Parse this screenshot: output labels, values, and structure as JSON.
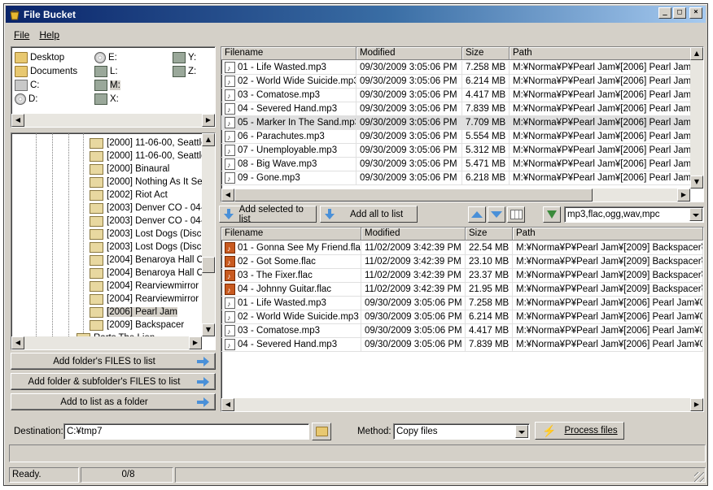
{
  "window": {
    "title": "File Bucket"
  },
  "menu": [
    {
      "label": "File"
    },
    {
      "label": "Help"
    }
  ],
  "drives": [
    {
      "label": "Desktop",
      "icon": "desktop-folder-icon"
    },
    {
      "label": "Documents",
      "icon": "documents-folder-icon"
    },
    {
      "label": "C:",
      "icon": "hard-drive-icon"
    },
    {
      "label": "D:",
      "icon": "cd-drive-icon"
    },
    {
      "label": "E:",
      "icon": "cd-drive-icon"
    },
    {
      "label": "L:",
      "icon": "network-drive-icon"
    },
    {
      "label": "M:",
      "icon": "network-drive-icon"
    },
    {
      "label": "X:",
      "icon": "network-drive-icon"
    },
    {
      "label": "Y:",
      "icon": "network-drive-icon"
    },
    {
      "label": "Z:",
      "icon": "network-drive-icon"
    }
  ],
  "tree": [
    "[2000] 11-06-00, Seattle",
    "[2000] 11-06-00, Seattle",
    "[2000] Binaural",
    "[2000] Nothing As It Se",
    "[2002] Riot Act",
    "[2003] Denver CO - 04-",
    "[2003] Denver CO - 04-",
    "[2003] Lost Dogs (Disc",
    "[2003] Lost Dogs (Disc",
    "[2004] Benaroya Hall O",
    "[2004] Benaroya Hall O",
    "[2004] Rearviewmirror (",
    "[2004] Rearviewmirror (",
    "[2006] Pearl Jam",
    "[2009] Backspacer",
    "Rarts The Lion"
  ],
  "tree_selected": "[2006] Pearl Jam",
  "left_buttons": [
    "Add folder's FILES to list",
    "Add folder & subfolder's FILES to list",
    "Add to list as a folder"
  ],
  "top_list": {
    "columns": [
      "Filename",
      "Modified",
      "Size",
      "Path"
    ],
    "rows": [
      [
        "01 - Life Wasted.mp3",
        "09/30/2009 3:05:06 PM",
        "7.258 MB",
        "M:¥Norma¥P¥Pearl Jam¥[2006] Pearl Jam¥01"
      ],
      [
        "02 - World Wide Suicide.mp3",
        "09/30/2009 3:05:06 PM",
        "6.214 MB",
        "M:¥Norma¥P¥Pearl Jam¥[2006] Pearl Jam¥02"
      ],
      [
        "03 - Comatose.mp3",
        "09/30/2009 3:05:06 PM",
        "4.417 MB",
        "M:¥Norma¥P¥Pearl Jam¥[2006] Pearl Jam¥03"
      ],
      [
        "04 - Severed Hand.mp3",
        "09/30/2009 3:05:06 PM",
        "7.839 MB",
        "M:¥Norma¥P¥Pearl Jam¥[2006] Pearl Jam¥04"
      ],
      [
        "05 - Marker In The Sand.mp3",
        "09/30/2009 3:05:06 PM",
        "7.709 MB",
        "M:¥Norma¥P¥Pearl Jam¥[2006] Pearl Jam¥05"
      ],
      [
        "06 - Parachutes.mp3",
        "09/30/2009 3:05:06 PM",
        "5.554 MB",
        "M:¥Norma¥P¥Pearl Jam¥[2006] Pearl Jam¥06"
      ],
      [
        "07 - Unemployable.mp3",
        "09/30/2009 3:05:06 PM",
        "5.312 MB",
        "M:¥Norma¥P¥Pearl Jam¥[2006] Pearl Jam¥07"
      ],
      [
        "08 - Big Wave.mp3",
        "09/30/2009 3:05:06 PM",
        "5.471 MB",
        "M:¥Norma¥P¥Pearl Jam¥[2006] Pearl Jam¥08"
      ],
      [
        "09 - Gone.mp3",
        "09/30/2009 3:05:06 PM",
        "6.218 MB",
        "M:¥Norma¥P¥Pearl Jam¥[2006] Pearl Jam¥09"
      ]
    ],
    "selected_index": 4
  },
  "toolbar": {
    "add_selected": "Add selected to list",
    "add_all": "Add all to list",
    "filter_value": "mp3,flac,ogg,wav,mpc"
  },
  "bottom_list": {
    "columns": [
      "Filename",
      "Modified",
      "Size",
      "Path"
    ],
    "rows": [
      [
        "01 - Gonna See My Friend.flac",
        "11/02/2009 3:42:39 PM",
        "22.54 MB",
        "M:¥Norma¥P¥Pearl Jam¥[2009] Backspacer¥01",
        "flac"
      ],
      [
        "02 - Got Some.flac",
        "11/02/2009 3:42:39 PM",
        "23.10 MB",
        "M:¥Norma¥P¥Pearl Jam¥[2009] Backspacer¥02",
        "flac"
      ],
      [
        "03 - The Fixer.flac",
        "11/02/2009 3:42:39 PM",
        "23.37 MB",
        "M:¥Norma¥P¥Pearl Jam¥[2009] Backspacer¥03",
        "flac"
      ],
      [
        "04 - Johnny Guitar.flac",
        "11/02/2009 3:42:39 PM",
        "21.95 MB",
        "M:¥Norma¥P¥Pearl Jam¥[2009] Backspacer¥04",
        "flac"
      ],
      [
        "01 - Life Wasted.mp3",
        "09/30/2009 3:05:06 PM",
        "7.258 MB",
        "M:¥Norma¥P¥Pearl Jam¥[2006] Pearl Jam¥01 - L",
        "mp3"
      ],
      [
        "02 - World Wide Suicide.mp3",
        "09/30/2009 3:05:06 PM",
        "6.214 MB",
        "M:¥Norma¥P¥Pearl Jam¥[2006] Pearl Jam¥02 - V",
        "mp3"
      ],
      [
        "03 - Comatose.mp3",
        "09/30/2009 3:05:06 PM",
        "4.417 MB",
        "M:¥Norma¥P¥Pearl Jam¥[2006] Pearl Jam¥03 - C",
        "mp3"
      ],
      [
        "04 - Severed Hand.mp3",
        "09/30/2009 3:05:06 PM",
        "7.839 MB",
        "M:¥Norma¥P¥Pearl Jam¥[2006] Pearl Jam¥04 - S",
        "mp3"
      ]
    ]
  },
  "destination": {
    "label": "Destination:",
    "value": "C:¥tmp7"
  },
  "method": {
    "label": "Method:",
    "value": "Copy files"
  },
  "process_button": "Process files",
  "status": {
    "text": "Ready.",
    "count": "0/8"
  },
  "colors": {
    "title_start": "#0a246a",
    "title_end": "#a6caf0",
    "accent": "#4a90d8",
    "selection": "#e0e0e0"
  }
}
